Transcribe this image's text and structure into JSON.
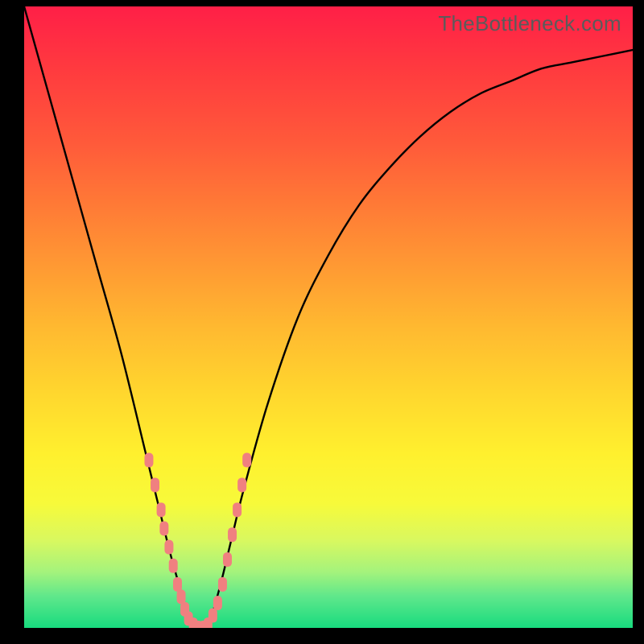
{
  "watermark": "TheBottleneck.com",
  "chart_data": {
    "type": "line",
    "title": "",
    "xlabel": "",
    "ylabel": "",
    "xlim": [
      0,
      100
    ],
    "ylim": [
      0,
      100
    ],
    "series": [
      {
        "name": "bottleneck-curve",
        "x": [
          0,
          4,
          8,
          12,
          16,
          20,
          22,
          24,
          26,
          27,
          28,
          30,
          32,
          34,
          36,
          40,
          45,
          50,
          55,
          60,
          65,
          70,
          75,
          80,
          85,
          90,
          95,
          100
        ],
        "y": [
          100,
          86,
          72,
          58,
          44,
          28,
          20,
          12,
          5,
          1,
          0,
          0,
          6,
          14,
          22,
          36,
          50,
          60,
          68,
          74,
          79,
          83,
          86,
          88,
          90,
          91,
          92,
          93
        ]
      }
    ],
    "markers": {
      "name": "highlighted-points",
      "color": "#f08080",
      "points": [
        {
          "x": 20.5,
          "y": 27
        },
        {
          "x": 21.5,
          "y": 23
        },
        {
          "x": 22.5,
          "y": 19
        },
        {
          "x": 23.0,
          "y": 16
        },
        {
          "x": 23.8,
          "y": 13
        },
        {
          "x": 24.5,
          "y": 10
        },
        {
          "x": 25.2,
          "y": 7
        },
        {
          "x": 25.8,
          "y": 5
        },
        {
          "x": 26.4,
          "y": 3
        },
        {
          "x": 27.0,
          "y": 1.5
        },
        {
          "x": 27.8,
          "y": 0.5
        },
        {
          "x": 28.6,
          "y": 0
        },
        {
          "x": 29.4,
          "y": 0
        },
        {
          "x": 30.2,
          "y": 0.5
        },
        {
          "x": 31.0,
          "y": 2
        },
        {
          "x": 31.8,
          "y": 4
        },
        {
          "x": 32.6,
          "y": 7
        },
        {
          "x": 33.4,
          "y": 11
        },
        {
          "x": 34.2,
          "y": 15
        },
        {
          "x": 35.0,
          "y": 19
        },
        {
          "x": 35.8,
          "y": 23
        },
        {
          "x": 36.6,
          "y": 27
        }
      ]
    },
    "gradient_background": {
      "top_color": "#ff1f47",
      "bottom_color": "#18db7e",
      "description": "Red (high bottleneck) to green (no bottleneck) gradient"
    }
  }
}
